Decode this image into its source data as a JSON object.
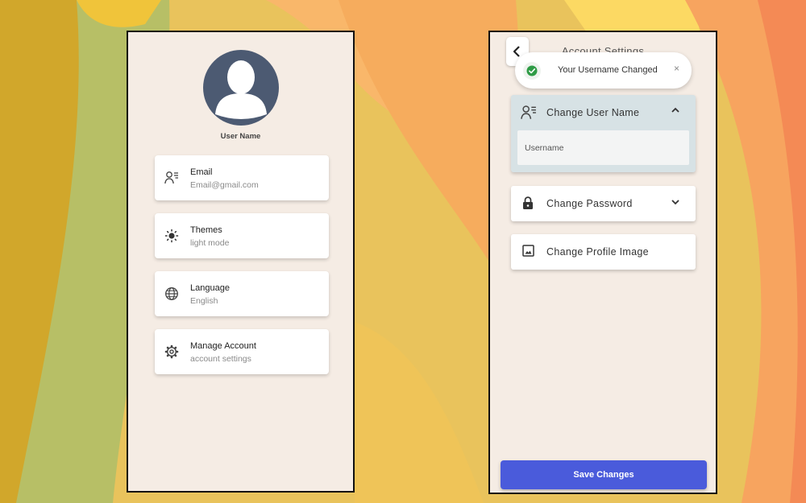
{
  "profile_screen": {
    "avatar_icon": "user-silhouette-icon",
    "user_name": "User Name",
    "items": [
      {
        "title": "Email",
        "subtitle": "Email@gmail.com",
        "icon": "contact-card-icon"
      },
      {
        "title": "Themes",
        "subtitle": "light mode",
        "icon": "sun-icon"
      },
      {
        "title": "Language",
        "subtitle": "English",
        "icon": "globe-icon"
      },
      {
        "title": "Manage Account",
        "subtitle": "account settings",
        "icon": "gear-icon"
      }
    ]
  },
  "settings_screen": {
    "title": "Account Settings",
    "back_icon": "chevron-left-icon",
    "toast": {
      "message": "Your Username Changed",
      "close_glyph": "×",
      "icon": "check-circle-icon",
      "color": "#2e9b45"
    },
    "sections": [
      {
        "label": "Change User Name",
        "icon": "contact-card-icon",
        "expanded": true,
        "field_label": "Username"
      },
      {
        "label": "Change Password",
        "icon": "lock-icon",
        "expanded": false
      },
      {
        "label": "Change Profile Image",
        "icon": "image-icon",
        "expanded": false
      }
    ],
    "save_label": "Save Changes"
  },
  "colors": {
    "screen_bg": "#f5ece4",
    "avatar_bg": "#4c5a72",
    "primary_button": "#4a5bdb",
    "expanded_section_bg": "#d7e2e5"
  }
}
